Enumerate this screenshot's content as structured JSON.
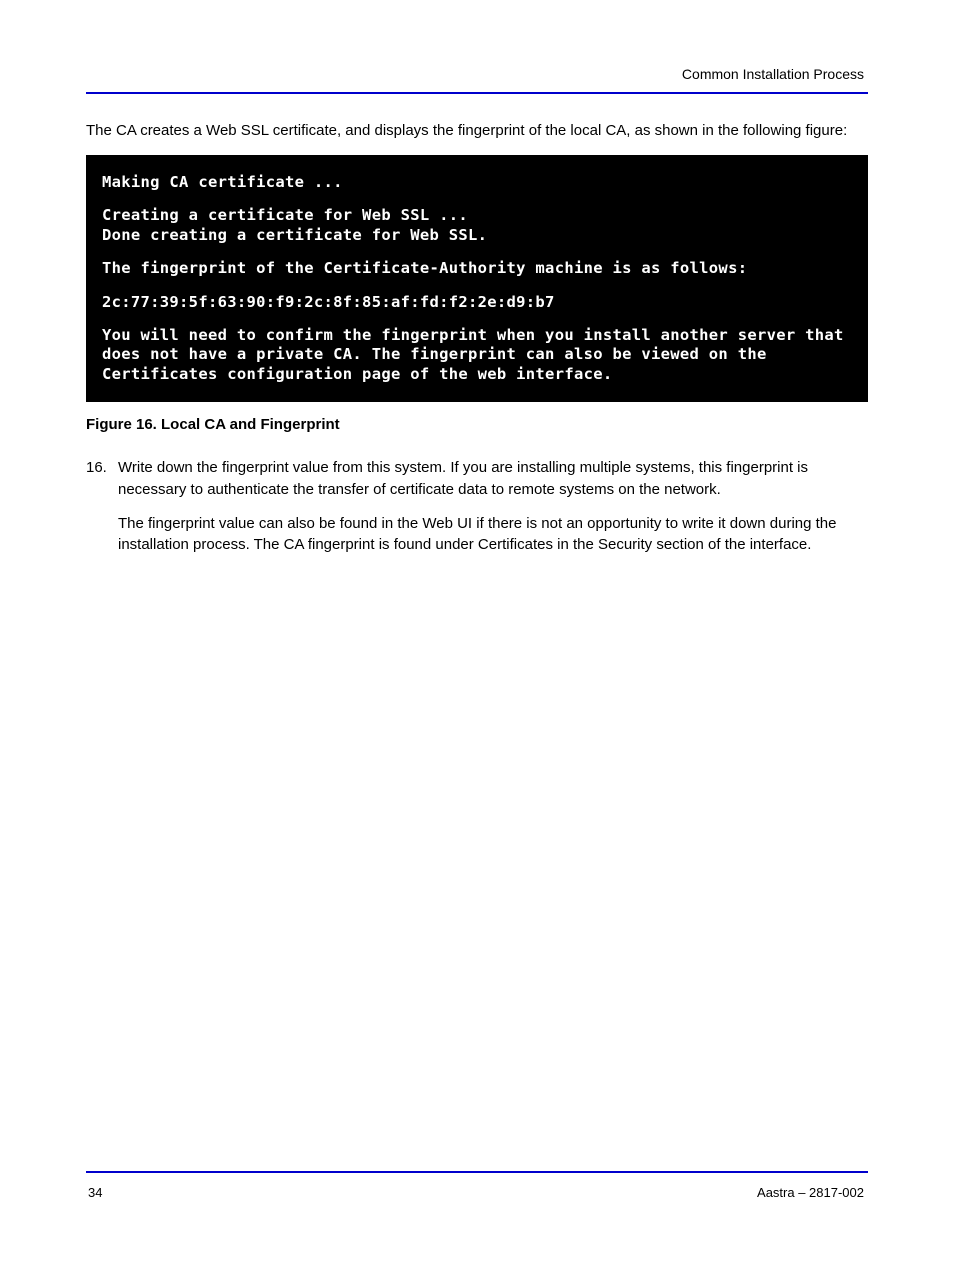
{
  "header": {
    "chapter_title": "Common Installation Process"
  },
  "footer": {
    "page_number": "34",
    "company": "Aastra – 2817-002"
  },
  "intro": "The CA creates a Web SSL certificate, and displays the fingerprint of the local CA, as shown in the following figure:",
  "figure": {
    "line1": "Making CA certificate ...",
    "line2": "Creating a certificate for Web SSL ...\nDone creating a certificate for Web SSL.",
    "line3": "The fingerprint of the Certificate-Authority machine is as follows:",
    "line4": "2c:77:39:5f:63:90:f9:2c:8f:85:af:fd:f2:2e:d9:b7",
    "line5": "You will need to confirm the fingerprint when you install another server that does not have a private CA. The fingerprint can also be viewed on the Certificates configuration page of the web interface.",
    "caption": "Figure 16. Local CA and Fingerprint"
  },
  "step": {
    "number": "16.",
    "p1": "Write down the fingerprint value from this system. If you are installing multiple systems, this fingerprint is necessary to authenticate the transfer of certificate data to remote systems on the network.",
    "p2": "The fingerprint value can also be found in the Web UI if there is not an opportunity to write it down during the installation process. The CA fingerprint is found under Certificates in the Security section of the interface."
  }
}
